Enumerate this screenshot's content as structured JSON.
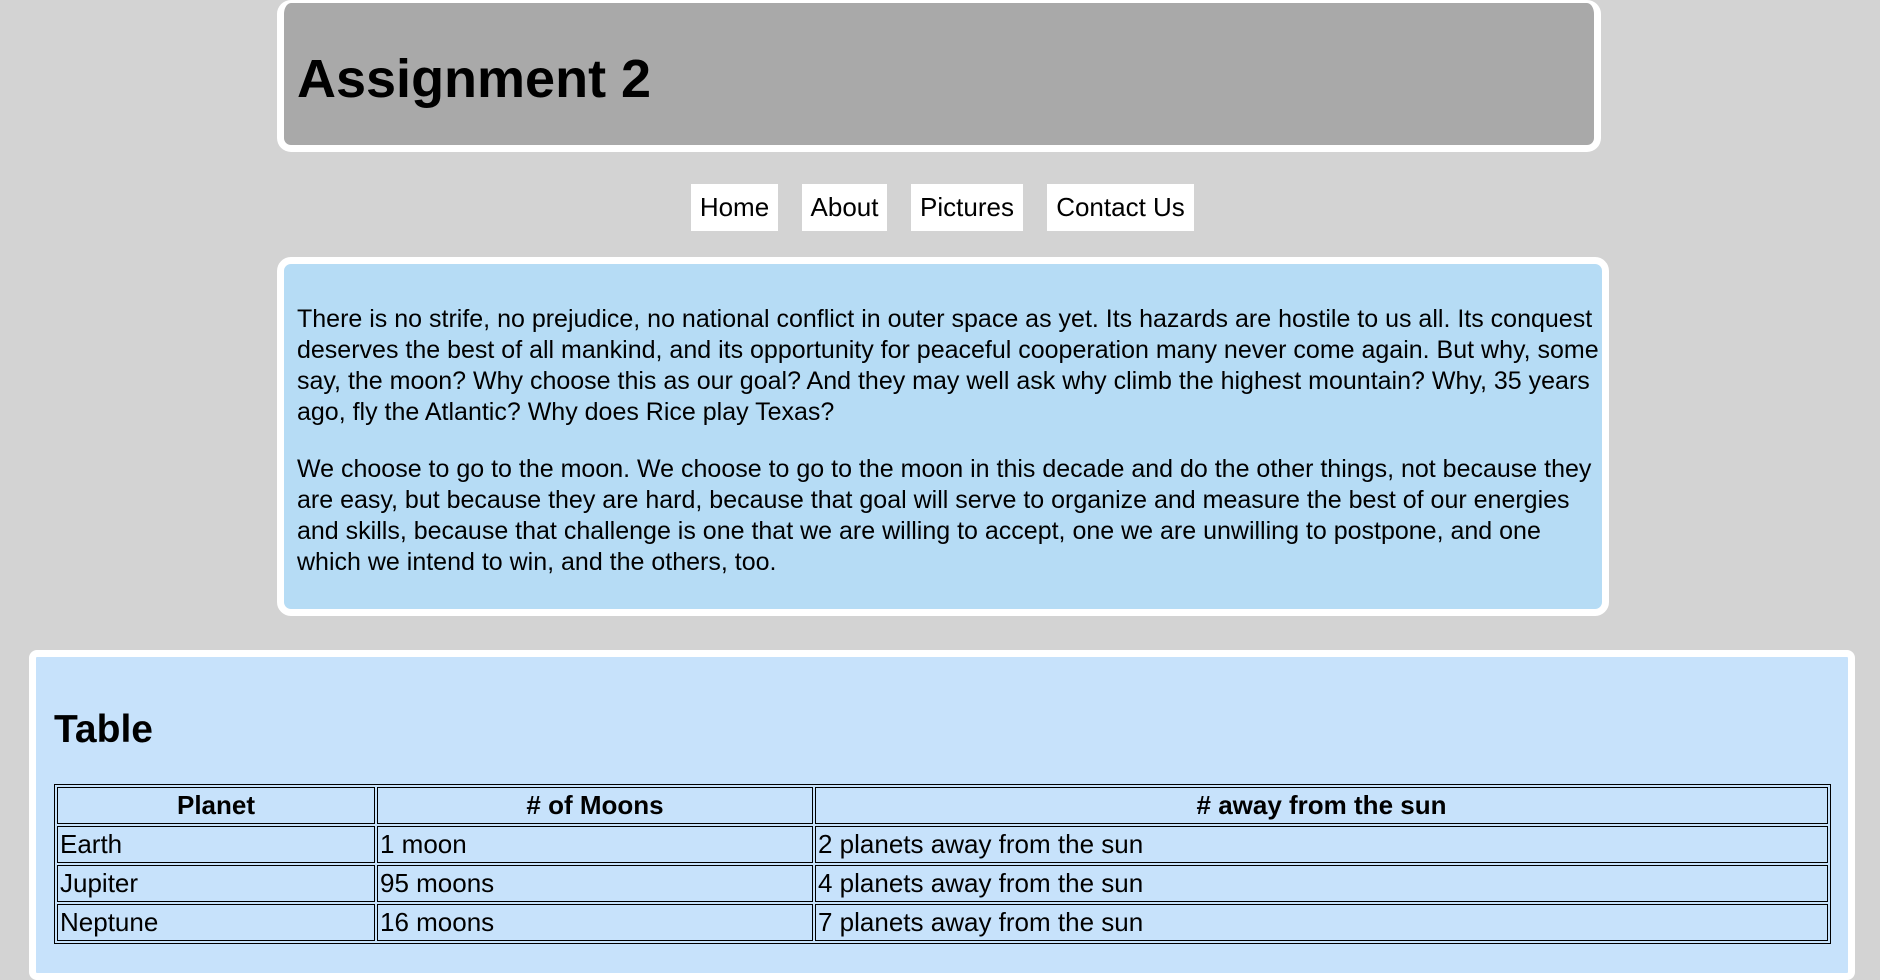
{
  "header": {
    "title": "Assignment 2"
  },
  "nav": {
    "items": [
      {
        "label": "Home"
      },
      {
        "label": "About"
      },
      {
        "label": "Pictures"
      },
      {
        "label": "Contact Us"
      }
    ]
  },
  "content": {
    "paragraphs": [
      "There is no strife, no prejudice, no national conflict in outer space as yet. Its hazards are hostile to us all. Its conquest deserves the best of all mankind, and its opportunity for peaceful cooperation many never come again. But why, some say, the moon? Why choose this as our goal? And they may well ask why climb the highest mountain? Why, 35 years ago, fly the Atlantic? Why does Rice play Texas?",
      "We choose to go to the moon. We choose to go to the moon in this decade and do the other things, not because they are easy, but because they are hard, because that goal will serve to organize and measure the best of our energies and skills, because that challenge is one that we are willing to accept, one we are unwilling to postpone, and one which we intend to win, and the others, too."
    ]
  },
  "table_section": {
    "title": "Table",
    "columns": [
      "Planet",
      "# of Moons",
      "# away from the sun"
    ],
    "rows": [
      [
        "Earth",
        "1 moon",
        "2 planets away from the sun"
      ],
      [
        "Jupiter",
        "95 moons",
        "4 planets away from the sun"
      ],
      [
        "Neptune",
        "16 moons",
        "7 planets away from the sun"
      ]
    ]
  }
}
